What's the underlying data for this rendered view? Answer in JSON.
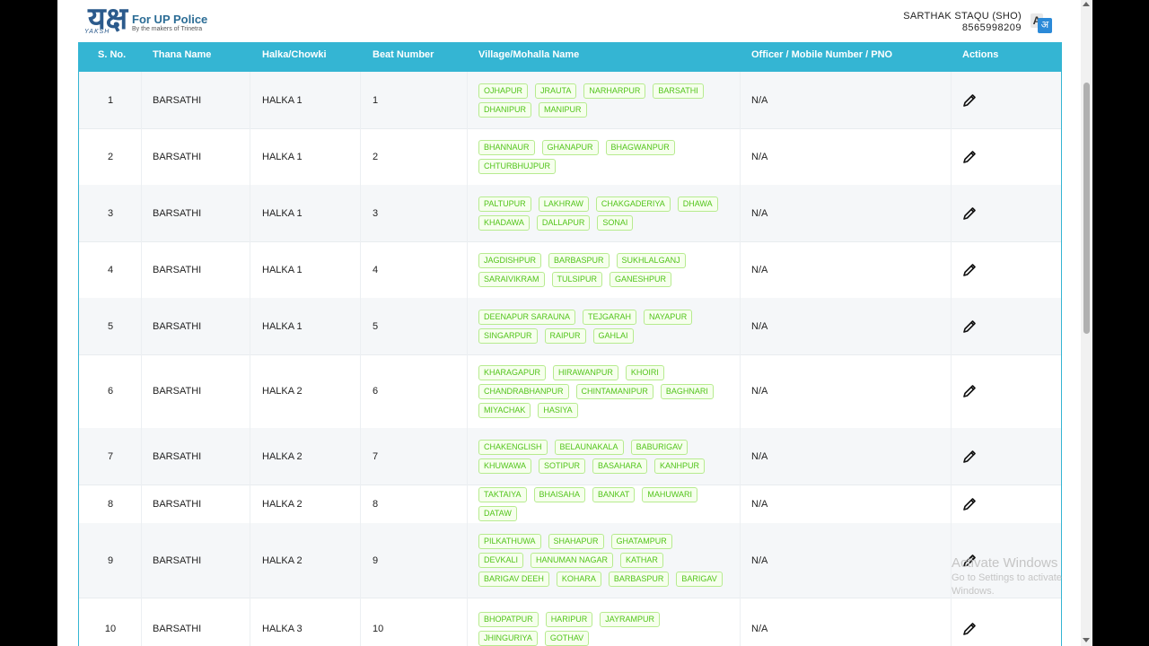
{
  "brand": {
    "logo_mark": "यक्ष",
    "logo_sub": "YAKSH",
    "title": "For UP Police",
    "tagline": "By the makers of Trinetra"
  },
  "user": {
    "name": "SARTHAK STAQU (SHO)",
    "phone": "8565998209",
    "lang_a": "A",
    "lang_b": "अ"
  },
  "table": {
    "headers": [
      "S. No.",
      "Thana Name",
      "Halka/Chowki",
      "Beat Number",
      "Village/Mohalla Name",
      "Officer / Mobile Number / PNO",
      "Actions"
    ],
    "rows": [
      {
        "sno": "1",
        "thana": "BARSATHI",
        "halka": "HALKA 1",
        "beat": "1",
        "villages": [
          "OJHAPUR",
          "JRAUTA",
          "NARHARPUR",
          "BARSATHI",
          "DHANIPUR",
          "MANIPUR"
        ],
        "officer": "N/A"
      },
      {
        "sno": "2",
        "thana": "BARSATHI",
        "halka": "HALKA 1",
        "beat": "2",
        "villages": [
          "BHANNAUR",
          "GHANAPUR",
          "BHAGWANPUR",
          "CHTURBHUJPUR"
        ],
        "officer": "N/A"
      },
      {
        "sno": "3",
        "thana": "BARSATHI",
        "halka": "HALKA 1",
        "beat": "3",
        "villages": [
          "PALTUPUR",
          "LAKHRAW",
          "CHAKGADERIYA",
          "DHAWA",
          "KHADAWA",
          "DALLAPUR",
          "SONAI"
        ],
        "officer": "N/A"
      },
      {
        "sno": "4",
        "thana": "BARSATHI",
        "halka": "HALKA 1",
        "beat": "4",
        "villages": [
          "JAGDISHPUR",
          "BARBASPUR",
          "SUKHLALGANJ",
          "SARAIVIKRAM",
          "TULSIPUR",
          "GANESHPUR"
        ],
        "officer": "N/A"
      },
      {
        "sno": "5",
        "thana": "BARSATHI",
        "halka": "HALKA 1",
        "beat": "5",
        "villages": [
          "DEENAPUR SARAUNA",
          "TEJGARAH",
          "NAYAPUR",
          "SINGARPUR",
          "RAIPUR",
          "GAHLAI"
        ],
        "officer": "N/A"
      },
      {
        "sno": "6",
        "thana": "BARSATHI",
        "halka": "HALKA 2",
        "beat": "6",
        "villages": [
          "KHARAGAPUR",
          "HIRAWANPUR",
          "KHOIRI",
          "CHANDRABHANPUR",
          "CHINTAMANIPUR",
          "BAGHNARI",
          "MIYACHAK",
          "HASIYA"
        ],
        "officer": "N/A"
      },
      {
        "sno": "7",
        "thana": "BARSATHI",
        "halka": "HALKA 2",
        "beat": "7",
        "villages": [
          "CHAKENGLISH",
          "BELAUNAKALA",
          "BABURIGAV",
          "KHUWAWA",
          "SOTIPUR",
          "BASAHARA",
          "KANHPUR"
        ],
        "officer": "N/A"
      },
      {
        "sno": "8",
        "thana": "BARSATHI",
        "halka": "HALKA 2",
        "beat": "8",
        "villages": [
          "TAKTAIYA",
          "BHAISAHA",
          "BANKAT",
          "MAHUWARI",
          "DATAW"
        ],
        "officer": "N/A"
      },
      {
        "sno": "9",
        "thana": "BARSATHI",
        "halka": "HALKA 2",
        "beat": "9",
        "villages": [
          "PILKATHUWA",
          "SHAHAPUR",
          "GHATAMPUR",
          "DEVKALI",
          "HANUMAN NAGAR",
          "KATHAR",
          "BARIGAV DEEH",
          "KOHARA",
          "BARBASPUR",
          "BARIGAV"
        ],
        "officer": "N/A"
      },
      {
        "sno": "10",
        "thana": "BARSATHI",
        "halka": "HALKA 3",
        "beat": "10",
        "villages": [
          "BHOPATPUR",
          "HARIPUR",
          "JAYRAMPUR",
          "JHINGURIYA",
          "GOTHAV"
        ],
        "officer": "N/A"
      }
    ]
  },
  "watermark": {
    "line1": "Activate Windows",
    "line2": "Go to Settings to activate Windows."
  }
}
